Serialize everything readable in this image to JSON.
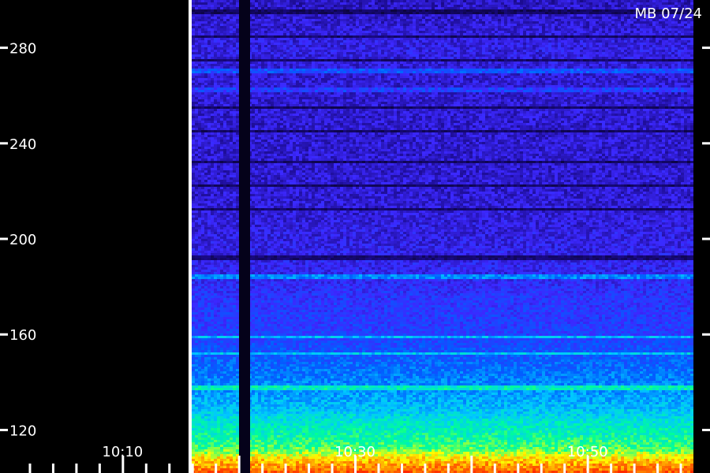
{
  "chart_data": {
    "type": "heatmap",
    "title": "",
    "stamp": "MB 07/24",
    "y_ticks": [
      120,
      160,
      200,
      240,
      280
    ],
    "y_tick_labels": [
      "120",
      "160",
      "200",
      "240",
      "280"
    ],
    "ylim": [
      102,
      300
    ],
    "x_tick_labels": [
      "10:10",
      "10:30",
      "10:50"
    ],
    "x_tick_minutes": [
      10,
      30,
      50
    ],
    "xlim_minutes": [
      0,
      60
    ],
    "data_start_minute": 16,
    "grid": false,
    "colormap": [
      "#000000",
      "#1a0a8a",
      "#3c28ff",
      "#0060ff",
      "#00c8ff",
      "#00ff96",
      "#ffff00",
      "#ff6000",
      "#ff0000"
    ],
    "intensity_profile": {
      "y": [
        300,
        290,
        280,
        260,
        240,
        220,
        200,
        185,
        175,
        160,
        150,
        140,
        130,
        124,
        118,
        112,
        108,
        104,
        102
      ],
      "level": [
        0.18,
        0.2,
        0.22,
        0.2,
        0.2,
        0.2,
        0.22,
        0.24,
        0.28,
        0.3,
        0.36,
        0.42,
        0.48,
        0.55,
        0.6,
        0.66,
        0.78,
        0.85,
        0.9
      ]
    },
    "bright_bands": [
      {
        "y": 184,
        "level": 0.42
      },
      {
        "y": 159,
        "level": 0.48
      },
      {
        "y": 152,
        "level": 0.5
      },
      {
        "y": 138,
        "level": 0.58
      },
      {
        "y": 270,
        "level": 0.34
      },
      {
        "y": 262,
        "level": 0.3
      }
    ],
    "dark_bands_y": [
      295,
      285,
      275,
      255,
      245,
      232,
      222,
      212,
      192
    ],
    "dropout_minutes": [
      [
        18.6,
        19.6
      ]
    ]
  }
}
